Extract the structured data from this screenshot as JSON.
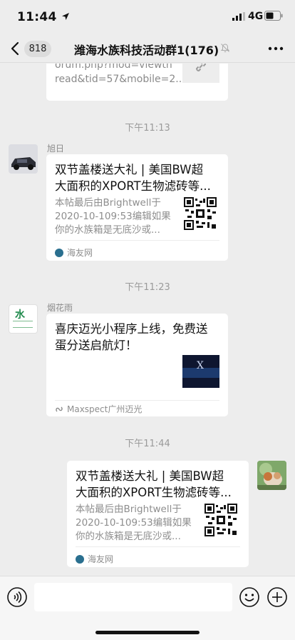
{
  "status_bar": {
    "time": "11:44",
    "network": "4G"
  },
  "nav": {
    "unread_count": "818",
    "title": "潍海水族科技活动群1(176)"
  },
  "messages": [
    {
      "type": "link_card_partial",
      "url_text_line1": "orum.php?mod=viewth",
      "url_text_line2": "read&tid=57&mobile=2..."
    },
    {
      "type": "time",
      "text": "下午11:13"
    },
    {
      "type": "link_card",
      "sender": "旭日",
      "title_line1": "双节盖楼送大礼 | 美国BW超",
      "title_line2": "大面积的XPORT生物滤砖等...",
      "desc_line1": "本帖最后由Brightwell于",
      "desc_line2": "2020-10-109:53编辑如果",
      "desc_line3": "你的水族箱是无底沙或...",
      "source": "海友网"
    },
    {
      "type": "time",
      "text": "下午11:23"
    },
    {
      "type": "miniprogram_card",
      "sender": "烟花雨",
      "avatar_text": "水",
      "title_line1": "喜庆迈光小程序上线，免费送",
      "title_line2": "蛋分送启航灯！",
      "thumb_text": "X",
      "source": "Maxspect广州迈光"
    },
    {
      "type": "time",
      "text": "下午11:44"
    },
    {
      "type": "link_card_self",
      "title_line1": "双节盖楼送大礼 | 美国BW超",
      "title_line2": "大面积的XPORT生物滤砖等...",
      "desc_line1": "本帖最后由Brightwell于",
      "desc_line2": "2020-10-109:53编辑如果",
      "desc_line3": "你的水族箱是无底沙或...",
      "source": "海友网"
    }
  ],
  "colors": {
    "background": "#ededed",
    "card": "#ffffff",
    "source_icon": "#2a6f8f"
  },
  "icons": [
    "location-arrow-icon",
    "signal-icon",
    "battery-icon",
    "back-chevron-icon",
    "mute-bell-icon",
    "more-dots-icon",
    "link-icon",
    "voice-icon",
    "emoji-icon",
    "plus-icon"
  ]
}
